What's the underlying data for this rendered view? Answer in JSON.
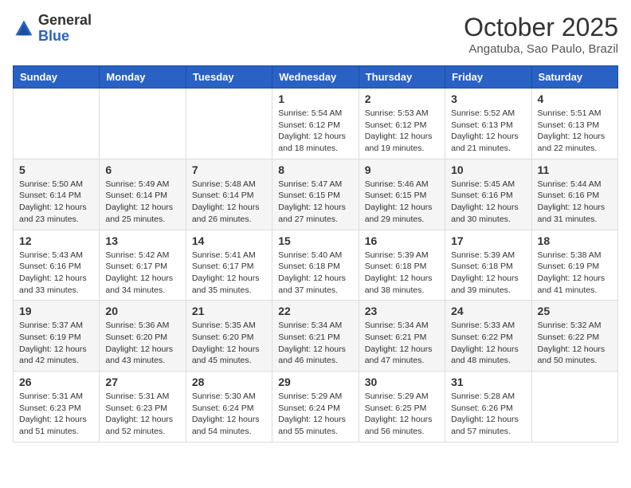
{
  "header": {
    "logo_general": "General",
    "logo_blue": "Blue",
    "month_title": "October 2025",
    "location": "Angatuba, Sao Paulo, Brazil"
  },
  "days_of_week": [
    "Sunday",
    "Monday",
    "Tuesday",
    "Wednesday",
    "Thursday",
    "Friday",
    "Saturday"
  ],
  "weeks": [
    [
      {
        "day": "",
        "info": ""
      },
      {
        "day": "",
        "info": ""
      },
      {
        "day": "",
        "info": ""
      },
      {
        "day": "1",
        "info": "Sunrise: 5:54 AM\nSunset: 6:12 PM\nDaylight: 12 hours and 18 minutes."
      },
      {
        "day": "2",
        "info": "Sunrise: 5:53 AM\nSunset: 6:12 PM\nDaylight: 12 hours and 19 minutes."
      },
      {
        "day": "3",
        "info": "Sunrise: 5:52 AM\nSunset: 6:13 PM\nDaylight: 12 hours and 21 minutes."
      },
      {
        "day": "4",
        "info": "Sunrise: 5:51 AM\nSunset: 6:13 PM\nDaylight: 12 hours and 22 minutes."
      }
    ],
    [
      {
        "day": "5",
        "info": "Sunrise: 5:50 AM\nSunset: 6:14 PM\nDaylight: 12 hours and 23 minutes."
      },
      {
        "day": "6",
        "info": "Sunrise: 5:49 AM\nSunset: 6:14 PM\nDaylight: 12 hours and 25 minutes."
      },
      {
        "day": "7",
        "info": "Sunrise: 5:48 AM\nSunset: 6:14 PM\nDaylight: 12 hours and 26 minutes."
      },
      {
        "day": "8",
        "info": "Sunrise: 5:47 AM\nSunset: 6:15 PM\nDaylight: 12 hours and 27 minutes."
      },
      {
        "day": "9",
        "info": "Sunrise: 5:46 AM\nSunset: 6:15 PM\nDaylight: 12 hours and 29 minutes."
      },
      {
        "day": "10",
        "info": "Sunrise: 5:45 AM\nSunset: 6:16 PM\nDaylight: 12 hours and 30 minutes."
      },
      {
        "day": "11",
        "info": "Sunrise: 5:44 AM\nSunset: 6:16 PM\nDaylight: 12 hours and 31 minutes."
      }
    ],
    [
      {
        "day": "12",
        "info": "Sunrise: 5:43 AM\nSunset: 6:16 PM\nDaylight: 12 hours and 33 minutes."
      },
      {
        "day": "13",
        "info": "Sunrise: 5:42 AM\nSunset: 6:17 PM\nDaylight: 12 hours and 34 minutes."
      },
      {
        "day": "14",
        "info": "Sunrise: 5:41 AM\nSunset: 6:17 PM\nDaylight: 12 hours and 35 minutes."
      },
      {
        "day": "15",
        "info": "Sunrise: 5:40 AM\nSunset: 6:18 PM\nDaylight: 12 hours and 37 minutes."
      },
      {
        "day": "16",
        "info": "Sunrise: 5:39 AM\nSunset: 6:18 PM\nDaylight: 12 hours and 38 minutes."
      },
      {
        "day": "17",
        "info": "Sunrise: 5:39 AM\nSunset: 6:18 PM\nDaylight: 12 hours and 39 minutes."
      },
      {
        "day": "18",
        "info": "Sunrise: 5:38 AM\nSunset: 6:19 PM\nDaylight: 12 hours and 41 minutes."
      }
    ],
    [
      {
        "day": "19",
        "info": "Sunrise: 5:37 AM\nSunset: 6:19 PM\nDaylight: 12 hours and 42 minutes."
      },
      {
        "day": "20",
        "info": "Sunrise: 5:36 AM\nSunset: 6:20 PM\nDaylight: 12 hours and 43 minutes."
      },
      {
        "day": "21",
        "info": "Sunrise: 5:35 AM\nSunset: 6:20 PM\nDaylight: 12 hours and 45 minutes."
      },
      {
        "day": "22",
        "info": "Sunrise: 5:34 AM\nSunset: 6:21 PM\nDaylight: 12 hours and 46 minutes."
      },
      {
        "day": "23",
        "info": "Sunrise: 5:34 AM\nSunset: 6:21 PM\nDaylight: 12 hours and 47 minutes."
      },
      {
        "day": "24",
        "info": "Sunrise: 5:33 AM\nSunset: 6:22 PM\nDaylight: 12 hours and 48 minutes."
      },
      {
        "day": "25",
        "info": "Sunrise: 5:32 AM\nSunset: 6:22 PM\nDaylight: 12 hours and 50 minutes."
      }
    ],
    [
      {
        "day": "26",
        "info": "Sunrise: 5:31 AM\nSunset: 6:23 PM\nDaylight: 12 hours and 51 minutes."
      },
      {
        "day": "27",
        "info": "Sunrise: 5:31 AM\nSunset: 6:23 PM\nDaylight: 12 hours and 52 minutes."
      },
      {
        "day": "28",
        "info": "Sunrise: 5:30 AM\nSunset: 6:24 PM\nDaylight: 12 hours and 54 minutes."
      },
      {
        "day": "29",
        "info": "Sunrise: 5:29 AM\nSunset: 6:24 PM\nDaylight: 12 hours and 55 minutes."
      },
      {
        "day": "30",
        "info": "Sunrise: 5:29 AM\nSunset: 6:25 PM\nDaylight: 12 hours and 56 minutes."
      },
      {
        "day": "31",
        "info": "Sunrise: 5:28 AM\nSunset: 6:26 PM\nDaylight: 12 hours and 57 minutes."
      },
      {
        "day": "",
        "info": ""
      }
    ]
  ]
}
